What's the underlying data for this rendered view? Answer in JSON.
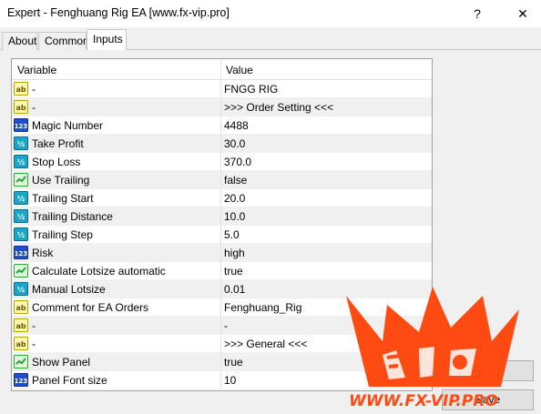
{
  "window": {
    "title": "Expert - Fenghuang Rig EA [www.fx-vip.pro]",
    "help_glyph": "?",
    "close_glyph": "✕"
  },
  "tabs": [
    {
      "label": "About"
    },
    {
      "label": "Common"
    },
    {
      "label": "Inputs"
    }
  ],
  "active_tab": "Inputs",
  "grid": {
    "headers": {
      "variable": "Variable",
      "value": "Value"
    },
    "rows": [
      {
        "type": "ab",
        "variable": "-",
        "value": "FNGG RIG"
      },
      {
        "type": "ab",
        "variable": "-",
        "value": ">>> Order Setting <<<"
      },
      {
        "type": "123",
        "variable": "Magic Number",
        "value": "4488"
      },
      {
        "type": "v2",
        "variable": "Take Profit",
        "value": "30.0"
      },
      {
        "type": "v2",
        "variable": "Stop Loss",
        "value": "370.0"
      },
      {
        "type": "bool",
        "variable": "Use Trailing",
        "value": "false"
      },
      {
        "type": "v2",
        "variable": "Trailing Start",
        "value": "20.0"
      },
      {
        "type": "v2",
        "variable": "Trailing Distance",
        "value": "10.0"
      },
      {
        "type": "v2",
        "variable": "Trailing Step",
        "value": "5.0"
      },
      {
        "type": "123",
        "variable": "Risk",
        "value": "high"
      },
      {
        "type": "bool",
        "variable": "Calculate Lotsize automatic",
        "value": "true"
      },
      {
        "type": "v2",
        "variable": "Manual Lotsize",
        "value": "0.01"
      },
      {
        "type": "ab",
        "variable": "Comment for EA Orders",
        "value": "Fenghuang_Rig"
      },
      {
        "type": "ab",
        "variable": "-",
        "value": "-"
      },
      {
        "type": "ab",
        "variable": "-",
        "value": ">>> General <<<"
      },
      {
        "type": "bool",
        "variable": "Show Panel",
        "value": "true"
      },
      {
        "type": "123",
        "variable": "Panel Font size",
        "value": "10"
      }
    ]
  },
  "buttons": {
    "load": "Load",
    "save": "Save"
  },
  "watermark": {
    "text": "WWW.FX-VIP.PRO",
    "color": "#ff4a12"
  },
  "colors": {
    "icon_ab": "#d8c200",
    "icon_123": "#1f4fd0",
    "icon_v2": "#1aa6c8",
    "icon_bool": "#28a836"
  }
}
